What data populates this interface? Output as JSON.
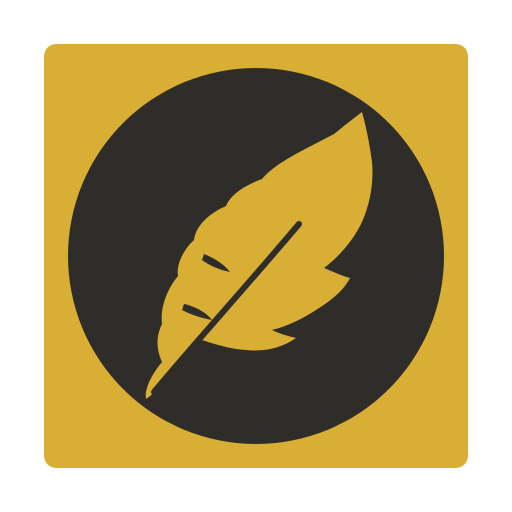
{
  "icon": {
    "name": "feather-app-icon",
    "background_color": "#D8AE34",
    "circle_color": "#2E2D2A",
    "feather_color": "#D8AE34"
  }
}
